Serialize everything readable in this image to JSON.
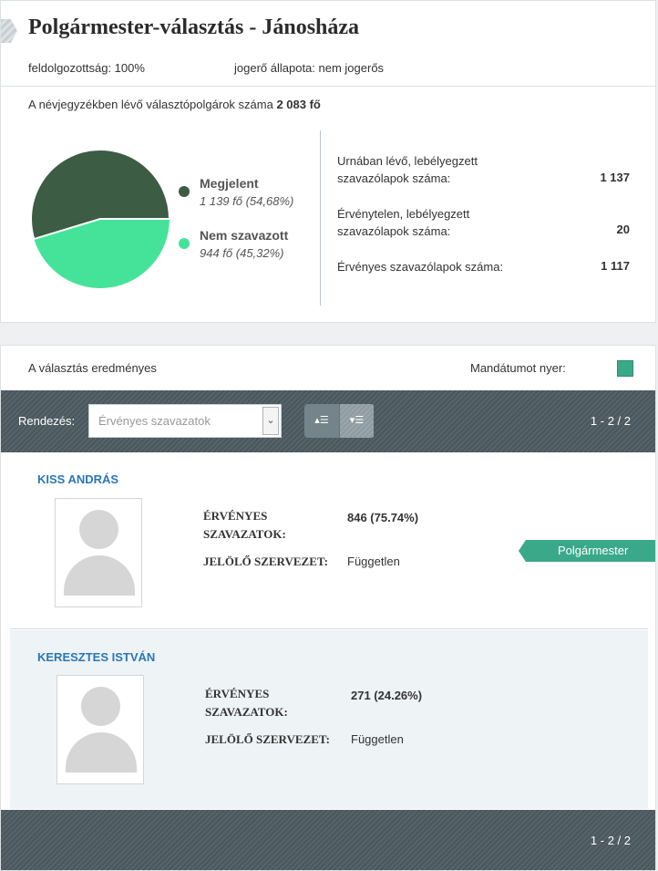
{
  "header": {
    "title": "Polgármester-választás - Jánosháza",
    "processed": "feldolgozottság: 100%",
    "legal_status": "jogerő állapota: nem jogerős"
  },
  "voters": {
    "label": "A névjegyzékben lévő választópolgárok száma",
    "count": "2 083 fő"
  },
  "turnout": {
    "appeared_label": "Megjelent",
    "appeared_value": "1 139 fő (54,68%)",
    "not_voted_label": "Nem szavazott",
    "not_voted_value": "944 fő (45,32%)",
    "appeared_fraction": 0.5468,
    "colors": {
      "appeared": "#3c5c44",
      "not_voted": "#45e39a"
    }
  },
  "stats": [
    {
      "label": "Urnában lévő, lebélyegzett szavazólapok száma:",
      "value": "1 137"
    },
    {
      "label": "Érvénytelen, lebélyegzett szavazólapok száma:",
      "value": "20"
    },
    {
      "label": "Érvényes szavazólapok száma:",
      "value": "1 117"
    }
  ],
  "results": {
    "status": "A választás eredményes",
    "mandate_label": "Mandátumot nyer:",
    "mandate_color": "#3aa98a"
  },
  "toolbar": {
    "sort_label": "Rendezés:",
    "sort_selected": "Érvényes szavazatok",
    "sort_asc_icon": "sort-ascending-icon",
    "sort_desc_icon": "sort-descending-icon",
    "pager": "1 - 2 / 2"
  },
  "candidates": [
    {
      "name": "KISS ANDRÁS",
      "votes_label": "ÉRVÉNYES SZAVAZATOK:",
      "votes_value": "846 (75.74%)",
      "org_label": "JELÖLŐ SZERVEZET:",
      "org_value": "Független",
      "badge": "Polgármester"
    },
    {
      "name": "KERESZTES ISTVÁN",
      "votes_label": "ÉRVÉNYES SZAVAZATOK:",
      "votes_value": "271 (24.26%)",
      "org_label": "JELÖLŐ SZERVEZET:",
      "org_value": "Független"
    }
  ],
  "footer": {
    "pager": "1 - 2 / 2"
  }
}
